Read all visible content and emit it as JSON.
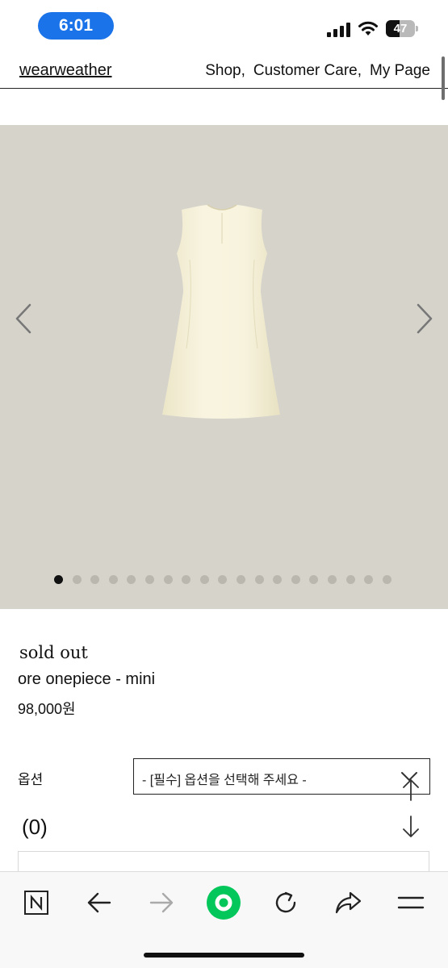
{
  "status": {
    "time": "6:01",
    "battery": "47",
    "battery_level": 0.47
  },
  "header": {
    "logo": "wearweather",
    "nav": [
      "Shop,",
      "Customer Care,",
      "My Page"
    ]
  },
  "gallery": {
    "slide_count": 19,
    "active_index": 0
  },
  "product": {
    "status": "sold out",
    "name": "ore onepiece - mini",
    "price": "98,000원"
  },
  "options": {
    "label": "옵션",
    "select_value": "- [필수] 옵션을 선택해 주세요 -"
  },
  "quantity": {
    "count": "(0)"
  },
  "toolbar": {
    "icons": [
      "naver-icon",
      "back-arrow-icon",
      "forward-arrow-icon",
      "green-home-icon",
      "refresh-icon",
      "share-icon",
      "menu-icon"
    ],
    "accent": "#03c75a"
  },
  "colors": {
    "time_pill": "#1a73e8",
    "image_bg": "#d6d3cb",
    "dress": "#f6f2dc"
  }
}
